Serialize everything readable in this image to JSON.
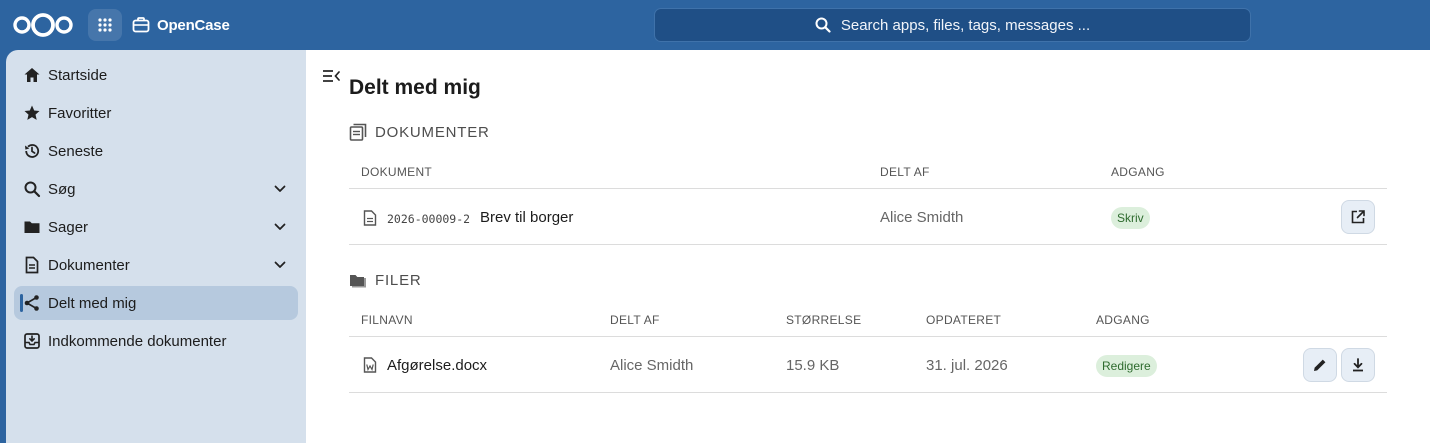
{
  "header": {
    "app_name": "OpenCase",
    "search_placeholder": "Search apps, files, tags, messages ..."
  },
  "sidebar": {
    "items": [
      {
        "label": "Startside",
        "icon": "home-icon"
      },
      {
        "label": "Favoritter",
        "icon": "star-icon"
      },
      {
        "label": "Seneste",
        "icon": "history-icon"
      },
      {
        "label": "Søg",
        "icon": "search-icon"
      },
      {
        "label": "Sager",
        "icon": "folder-icon"
      },
      {
        "label": "Dokumenter",
        "icon": "document-icon"
      },
      {
        "label": "Delt med mig",
        "icon": "share-icon"
      },
      {
        "label": "Indkommende dokumenter",
        "icon": "inbox-icon"
      }
    ]
  },
  "main": {
    "title": "Delt med mig",
    "documents": {
      "title": "DOKUMENTER",
      "columns": [
        "DOKUMENT",
        "DELT AF",
        "ADGANG"
      ],
      "rows": [
        {
          "number": "2026-00009-2",
          "title": "Brev til borger",
          "shared_by": "Alice Smidth",
          "access": "Skriv"
        }
      ]
    },
    "files": {
      "title": "FILER",
      "columns": [
        "FILNAVN",
        "DELT AF",
        "STØRRELSE",
        "OPDATERET",
        "ADGANG"
      ],
      "rows": [
        {
          "name": "Afgørelse.docx",
          "shared_by": "Alice Smidth",
          "size": "15.9 KB",
          "updated": "31. jul. 2026",
          "access": "Redigere"
        }
      ]
    }
  },
  "colors": {
    "brand": "#2d64a0",
    "sidebar": "#d5e0ec",
    "active_item": "#b6c9de",
    "badge_bg": "#dcefdc",
    "badge_text": "#2e6b2e"
  }
}
